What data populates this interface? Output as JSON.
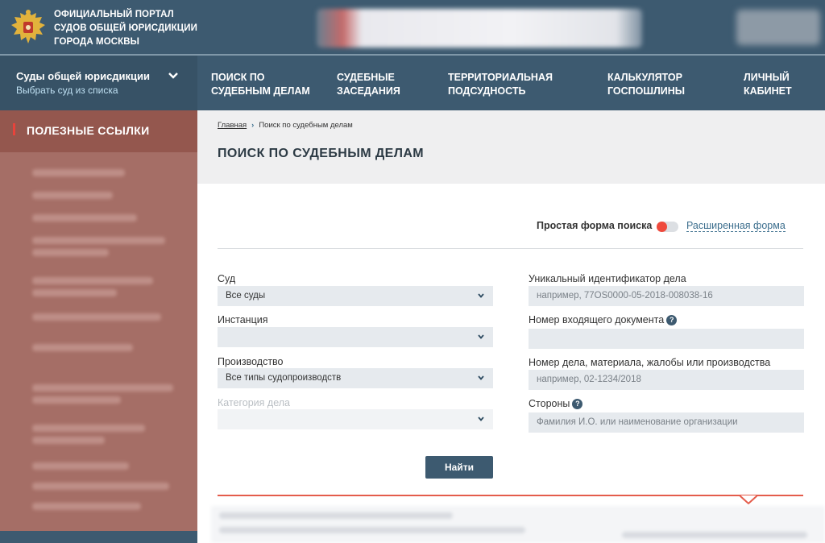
{
  "header": {
    "portal_title_lines": [
      "Официальный портал",
      "судов общей юрисдикции",
      "города Москвы"
    ],
    "emblem_icon": "russian-coat-of-arms-icon"
  },
  "nav": {
    "court_select": {
      "title": "Суды общей юрисдикции",
      "subtitle": "Выбрать суд из списка"
    },
    "items": [
      {
        "line1": "Поиск по",
        "line2": "судебным делам"
      },
      {
        "line1": "Судебные",
        "line2": "заседания"
      },
      {
        "line1": "Территориальная",
        "line2": "подсудность"
      },
      {
        "line1": "Калькулятор",
        "line2": "госпошлины"
      },
      {
        "line1": "Личный",
        "line2": "кабинет"
      }
    ]
  },
  "sidebar": {
    "heading": "Полезные ссылки"
  },
  "breadcrumb": {
    "home": "Главная",
    "current": "Поиск по судебным делам"
  },
  "page": {
    "title": "Поиск по судебным делам"
  },
  "search_mode": {
    "simple_label": "Простая форма поиска",
    "advanced_label": "Расширенная форма",
    "toggle_on": false
  },
  "form": {
    "court": {
      "label": "Суд",
      "value": "Все суды"
    },
    "instance": {
      "label": "Инстанция",
      "value": ""
    },
    "proceeding": {
      "label": "Производство",
      "value": "Все типы судопроизводств"
    },
    "category": {
      "label": "Категория дела",
      "value": ""
    },
    "uid": {
      "label": "Уникальный идентификатор дела",
      "placeholder": "например, 77OS0000-05-2018-008038-16"
    },
    "incoming_doc": {
      "label": "Номер входящего документа",
      "placeholder": ""
    },
    "case_number": {
      "label": "Номер дела, материала, жалобы или производства",
      "placeholder": "например, 02-1234/2018"
    },
    "parties": {
      "label": "Стороны",
      "placeholder": "Фамилия И.О. или наименование организации"
    },
    "help_glyph": "?",
    "submit_label": "Найти"
  },
  "colors": {
    "header_bg": "#3d5a70",
    "sidebar_bg": "#a56e66",
    "accent_red": "#e45c4b",
    "button_bg": "#3d5a70"
  }
}
